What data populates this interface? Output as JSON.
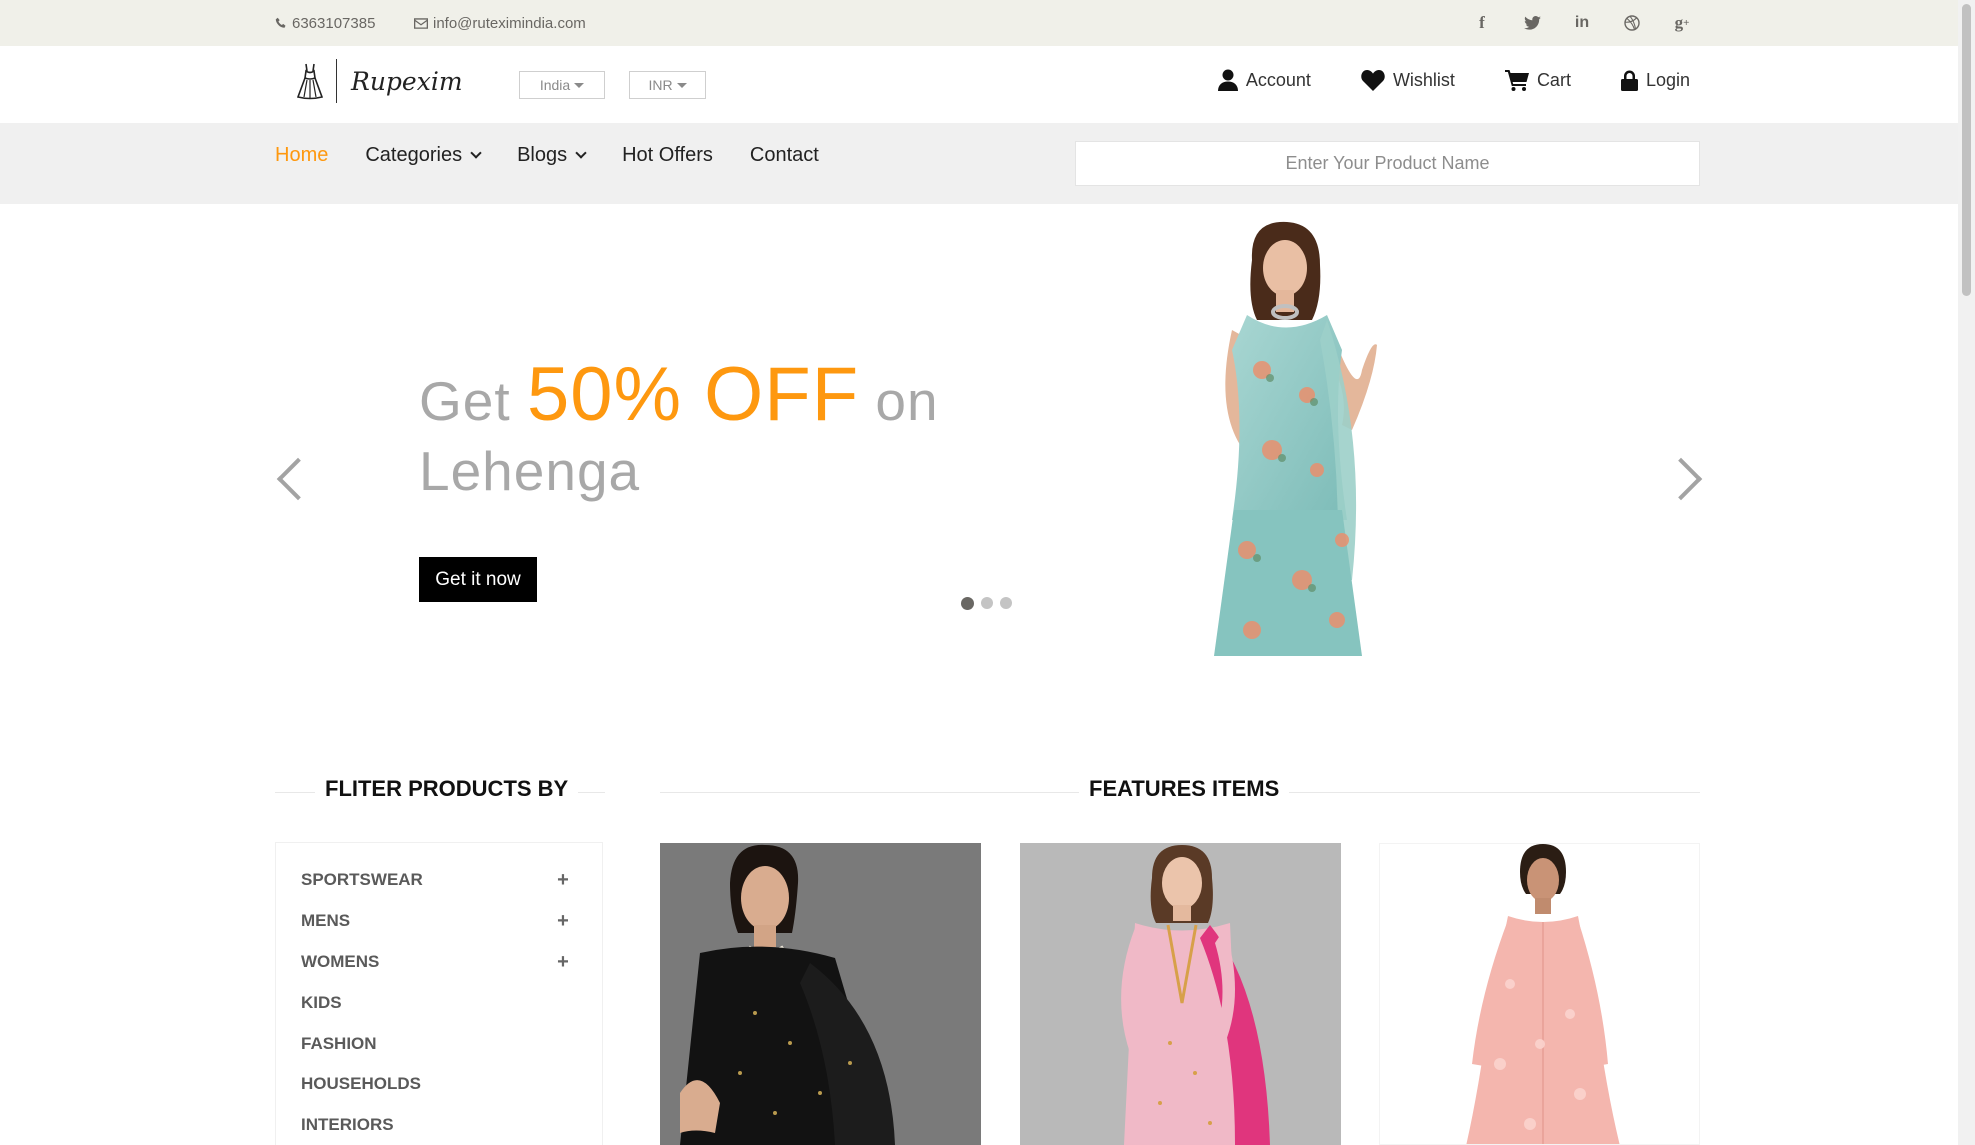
{
  "topbar": {
    "phone": "6363107385",
    "email": "info@ruteximindia.com",
    "socials": [
      {
        "name": "facebook-icon",
        "glyph": "f"
      },
      {
        "name": "twitter-icon",
        "glyph": "t"
      },
      {
        "name": "linkedin-icon",
        "glyph": "in"
      },
      {
        "name": "dribbble-icon",
        "glyph": "◎"
      },
      {
        "name": "google-plus-icon",
        "glyph": "g+"
      }
    ]
  },
  "header": {
    "brand": "Rupexim",
    "country": "India",
    "currency": "INR",
    "user_nav": [
      {
        "label": "Account",
        "icon": "user-icon"
      },
      {
        "label": "Wishlist",
        "icon": "heart-icon"
      },
      {
        "label": "Cart",
        "icon": "cart-icon"
      },
      {
        "label": "Login",
        "icon": "lock-icon"
      }
    ]
  },
  "nav": {
    "links": [
      {
        "label": "Home",
        "active": true,
        "dropdown": false
      },
      {
        "label": "Categories",
        "active": false,
        "dropdown": true
      },
      {
        "label": "Blogs",
        "active": false,
        "dropdown": true
      },
      {
        "label": "Hot Offers",
        "active": false,
        "dropdown": false
      },
      {
        "label": "Contact",
        "active": false,
        "dropdown": false
      }
    ],
    "search_placeholder": "Enter Your Product Name"
  },
  "slider": {
    "promo_prefix": "Get",
    "promo_offer": "50% OFF",
    "promo_suffix": "on",
    "promo_product": "Lehenga",
    "cta_label": "Get it now",
    "slide_count": 3,
    "active_slide": 1
  },
  "filter": {
    "title": "FLITER PRODUCTS BY",
    "categories": [
      {
        "label": "SPORTSWEAR",
        "expandable": true
      },
      {
        "label": "MENS",
        "expandable": true
      },
      {
        "label": "WOMENS",
        "expandable": true
      },
      {
        "label": "KIDS",
        "expandable": false
      },
      {
        "label": "FASHION",
        "expandable": false
      },
      {
        "label": "HOUSEHOLDS",
        "expandable": false
      },
      {
        "label": "INTERIORS",
        "expandable": false
      }
    ]
  },
  "features": {
    "title": "FEATURES ITEMS"
  },
  "colors": {
    "accent": "#fe980f",
    "topbar_bg": "#f0f0e9",
    "nav_bg": "#f0f0f0",
    "text_muted": "#696763"
  }
}
